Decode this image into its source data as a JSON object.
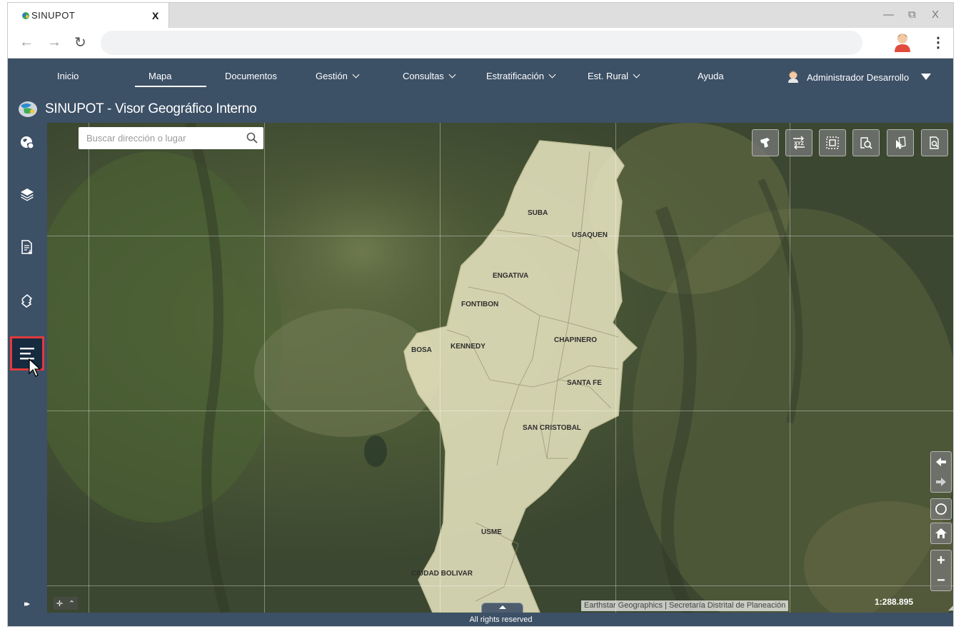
{
  "browser": {
    "tab_title": "SINUPOT",
    "tab_close": "X",
    "win_minimize": "—",
    "win_restore": "⧉",
    "win_close": "X",
    "back": "←",
    "forward": "→",
    "reload": "↻",
    "menu": "⋮"
  },
  "app_nav": {
    "items": [
      "Inicio",
      "Mapa",
      "Documentos",
      "Gestión",
      "Consultas",
      "Estratificación",
      "Est. Rural",
      "Ayuda"
    ],
    "active": "Mapa",
    "user": "Administrador Desarrollo"
  },
  "title": "SINUPOT - Visor Geográfico Interno",
  "search": {
    "placeholder": "Buscar dirección o lugar"
  },
  "sidebar": {
    "items": [
      "globe-icon",
      "layers-icon",
      "document-icon",
      "puzzle-icon",
      "menu-icon"
    ],
    "active": "menu-icon",
    "expand": "▸▸"
  },
  "map_tools": [
    "measure-icon",
    "xyz-coordinates-icon",
    "select-area-icon",
    "search-map-icon",
    "identify-icon",
    "print-preview-icon"
  ],
  "map_nav": {
    "back": "🡄",
    "forward": "🡆",
    "zoom_in": "+",
    "zoom_out": "−"
  },
  "districts": [
    "SUBA",
    "USAQUEN",
    "ENGATIVA",
    "FONTIBON",
    "KENNEDY",
    "BOSA",
    "CHAPINERO",
    "SANTA FE",
    "SAN CRISTOBAL",
    "USME",
    "CIUDAD BOLIVAR"
  ],
  "attribution": "Earthstar Geographics | Secretaría Distrital de Planeación",
  "scale": "1:288.895",
  "footer": "All rights reserved",
  "colors": {
    "header": "#3c5066",
    "active_sidebar": "#162a40",
    "highlight": "#e2393b",
    "city_fill": "#e9e6c2"
  }
}
